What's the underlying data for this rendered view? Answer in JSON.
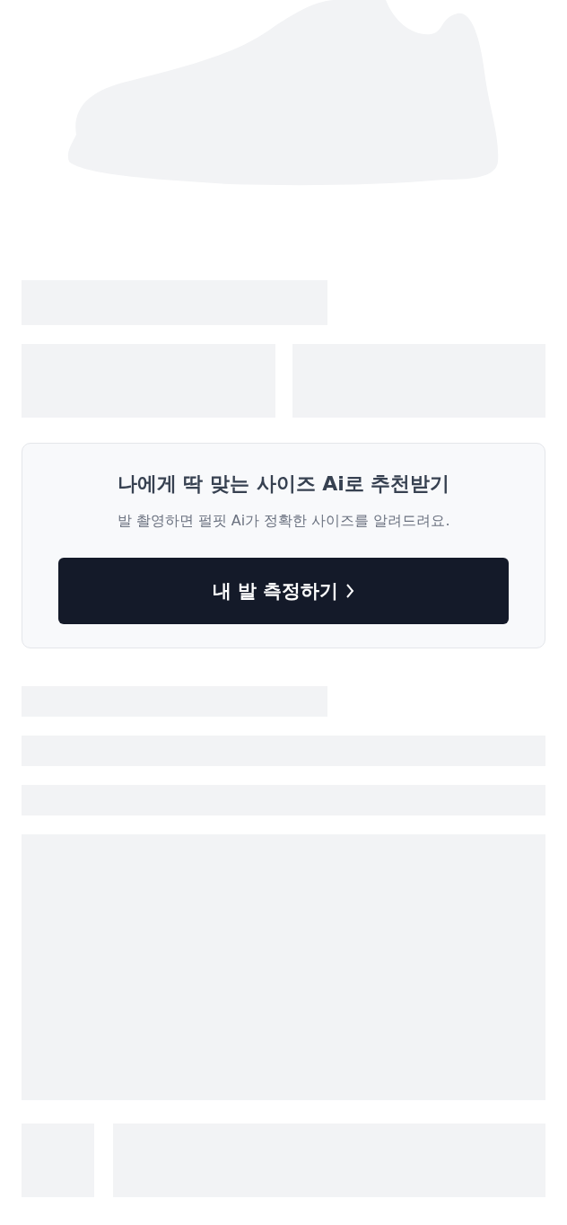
{
  "size_card": {
    "title": "나에게 딱 맞는 사이즈 Ai로 추천받기",
    "subtitle": "발 촬영하면 펄핏 Ai가 정확한 사이즈를 알려드려요.",
    "button": {
      "label": "내 발 측정하기"
    }
  }
}
